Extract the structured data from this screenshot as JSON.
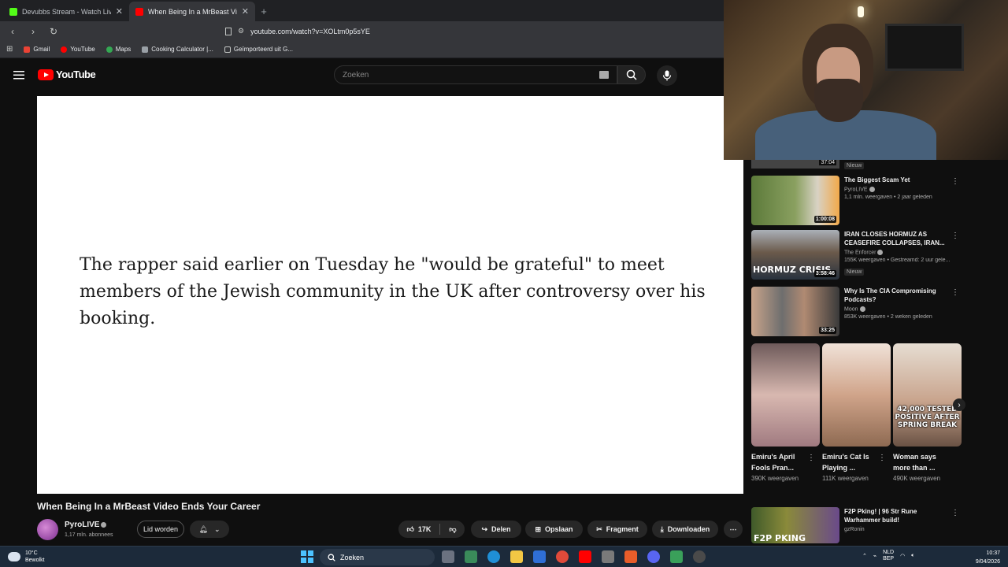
{
  "browser": {
    "tabs": [
      {
        "title": "Devubbs Stream - Watch Live on",
        "active": false
      },
      {
        "title": "When Being In a MrBeast Vid",
        "active": true
      }
    ],
    "url": "youtube.com/watch?v=XOLtm0p5sYE",
    "bookmarks": [
      "Gmail",
      "YouTube",
      "Maps",
      "Cooking Calculator |...",
      "Geïmporteerd uit G..."
    ]
  },
  "youtube": {
    "logo_text": "YouTube",
    "search_placeholder": "Zoeken"
  },
  "video": {
    "quote": "The rapper said earlier on Tuesday he \"would be grateful\" to meet members of the Jewish community in the UK after controversy over his booking.",
    "title": "When Being In a MrBeast Video Ends Your Career",
    "channel": "PyroLIVE",
    "subscribers": "1,17 mln. abonnees",
    "join_label": "Lid worden",
    "likes": "17K",
    "share_label": "Delen",
    "save_label": "Opslaan",
    "clip_label": "Fragment",
    "download_label": "Downloaden"
  },
  "sidebar": {
    "partial": {
      "duration": "37:04",
      "badge": "Nieuw"
    },
    "videos": [
      {
        "title": "The Biggest Scam Yet",
        "channel": "PyroLIVE",
        "meta": "1,1 mln. weergaven • 2 jaar geleden",
        "duration": "1:00:08",
        "badge": ""
      },
      {
        "title": "IRAN CLOSES HORMUZ AS CEASEFIRE COLLAPSES, IRAN...",
        "channel": "The Enforcer",
        "meta": "155K weergaven • Gestreamd: 2 uur gele...",
        "duration": "3:58:46",
        "badge": "Nieuw",
        "thumb_text": "HORMUZ CRISIS"
      },
      {
        "title": "Why Is The CIA Compromising Podcasts?",
        "channel": "Moon",
        "meta": "853K weergaven • 2 weken geleden",
        "duration": "33:25",
        "badge": ""
      }
    ],
    "shorts": [
      {
        "title": "Emiru's April Fools Pran...",
        "views": "390K weergaven"
      },
      {
        "title": "Emiru's Cat Is Playing ...",
        "views": "111K weergaven"
      },
      {
        "title": "Woman says more than ...",
        "views": "490K weergaven",
        "overlay": "42,000 TESTED POSITIVE AFTER SPRING BREAK"
      }
    ],
    "bottom": {
      "title": "F2P Pking! | 96 Str Rune Warhammer build!",
      "channel": "gzRonin",
      "thumb_text": "F2P PKING"
    }
  },
  "taskbar": {
    "weather_temp": "10°C",
    "weather_desc": "Bewolkt",
    "search_label": "Zoeken",
    "lang_top": "NLD",
    "lang_bottom": "BEP",
    "time": "10:37",
    "date": "9/04/2026"
  },
  "colors": {
    "youtube_red": "#ff0000",
    "background": "#0f0f0f",
    "accent_blue": "#4cc2ff"
  }
}
